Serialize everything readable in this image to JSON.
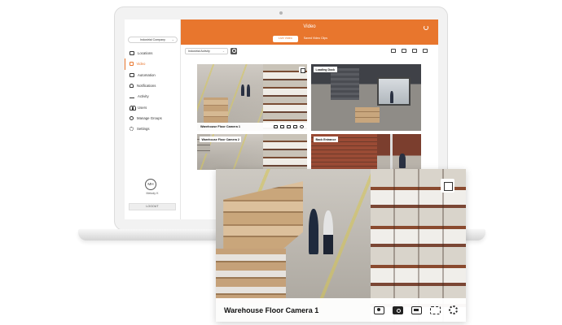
{
  "sidebar": {
    "company": "Industrial Company",
    "items": [
      {
        "label": "Locations",
        "icon": "building-icon"
      },
      {
        "label": "Video",
        "icon": "video-camera-icon",
        "active": true
      },
      {
        "label": "Automation",
        "icon": "automation-icon"
      },
      {
        "label": "Notifications",
        "icon": "bell-icon"
      },
      {
        "label": "Activity",
        "icon": "activity-icon"
      },
      {
        "label": "Users",
        "icon": "users-icon"
      },
      {
        "label": "Manage Groups",
        "icon": "groups-icon"
      },
      {
        "label": "Settings",
        "icon": "gear-icon"
      }
    ],
    "user_initials": "MH",
    "user_name": "Melody K",
    "logout": "LOGOUT"
  },
  "header": {
    "title": "Video",
    "tabs": [
      {
        "label": "Live Video",
        "active": true
      },
      {
        "label": "Saved Video Clips",
        "active": false
      }
    ]
  },
  "toolbar": {
    "filter": "Industrial Activity"
  },
  "cameras": [
    {
      "label": "Warehouse Floor Camera 1"
    },
    {
      "label": "Loading Dock"
    },
    {
      "label": "Warehouse Floor Camera 2"
    },
    {
      "label": "Back Entrance"
    }
  ],
  "enlarged": {
    "label": "Warehouse Floor Camera 1"
  },
  "colors": {
    "accent": "#e8762d"
  }
}
